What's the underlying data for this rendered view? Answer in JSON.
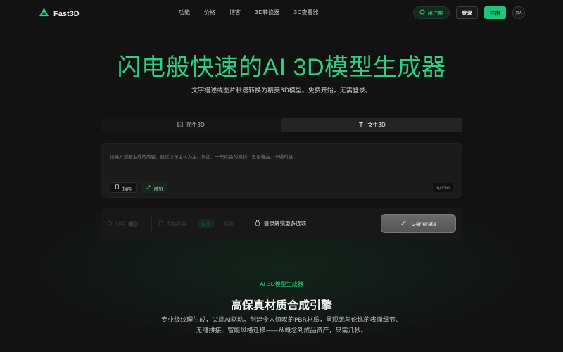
{
  "nav": {
    "brand": "Fast3D",
    "links": [
      "功能",
      "价格",
      "博客",
      "3D转换器",
      "3D查看器"
    ],
    "user_group": "用户群",
    "login": "登录",
    "register": "注册",
    "lang": "文A"
  },
  "hero": {
    "title": "闪电般快速的AI 3D模型生成器",
    "subtitle": "文字描述或图片秒速转换为精美3D模型。免费开始，无需登录。"
  },
  "tabs": [
    {
      "label": "图生3D",
      "icon": "image-icon",
      "active": false
    },
    {
      "label": "文生3D",
      "icon": "text-icon",
      "active": true
    }
  ],
  "prompt": {
    "placeholder": "请输入想要生成的内容，建议以单主体为主。例如：一只棕色的海豹，黑色卷曲，卡通风格",
    "guide": "指南",
    "random": "随机",
    "count": "0/150"
  },
  "options": {
    "opt1": "说明",
    "opt2": "网格数量",
    "opt3": "标准",
    "opt4": "精细",
    "unlock": "登录解锁更多选项",
    "generate": "Generate"
  },
  "feature": {
    "tag": "AI 3D模型生成器",
    "title": "高保真材质合成引擎",
    "desc": "专业级纹理生成，尖端AI驱动。创建令人惊叹的PBR材质，呈现无与伦比的表面细节、无缝拼接、智能风格迁移——从概念到成品资产，只需几秒。"
  },
  "colors": {
    "accent": "#2ecf82",
    "background": "#121212"
  }
}
